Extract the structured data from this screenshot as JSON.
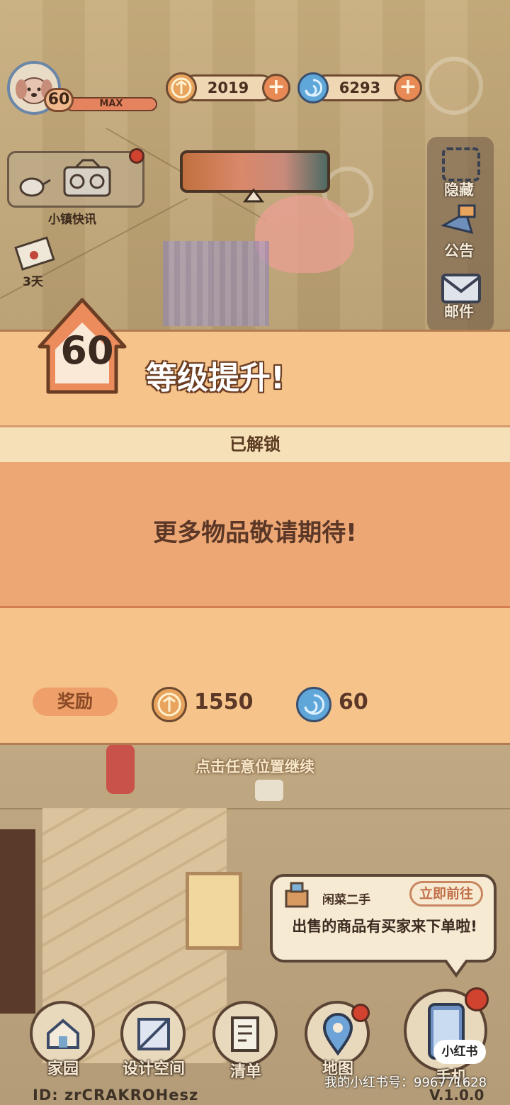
{
  "player": {
    "level": "60",
    "xp_label": "MAX"
  },
  "currency": {
    "coins": "2019",
    "gems": "6293",
    "plus_symbol": "+"
  },
  "widgets": {
    "news_label": "小镇快讯",
    "letter_days": "3天"
  },
  "side_menu": [
    {
      "label": "隐藏",
      "icon": "hide-icon"
    },
    {
      "label": "公告",
      "icon": "announcement-icon"
    },
    {
      "label": "邮件",
      "icon": "mail-icon"
    }
  ],
  "levelup": {
    "level": "60",
    "title": "等级提升!",
    "unlocked_header": "已解锁",
    "message": "更多物品敬请期待!",
    "reward_label": "奖励",
    "reward_coins": "1550",
    "reward_gems": "60",
    "continue_hint": "点击任意位置继续"
  },
  "notification": {
    "source": "闲菜二手",
    "button": "立即前往",
    "message": "出售的商品有买家来下单啦!"
  },
  "nav": [
    {
      "label": "家园",
      "icon": "home-icon"
    },
    {
      "label": "设计空间",
      "icon": "design-space-icon"
    },
    {
      "label": "清单",
      "icon": "list-icon"
    },
    {
      "label": "地图",
      "icon": "map-icon"
    },
    {
      "label": "手机",
      "icon": "phone-icon"
    }
  ],
  "footer": {
    "user_id": "ID: zrCRAKROHesz",
    "version": "V.1.0.0"
  },
  "watermark": {
    "logo": "小红书",
    "text": "我的小红书号：996771628"
  },
  "colors": {
    "modal_bg": "#f6c48a",
    "content_bg": "#eda775",
    "accent_orange": "#e78a55",
    "gem_blue": "#5fa6d9"
  }
}
